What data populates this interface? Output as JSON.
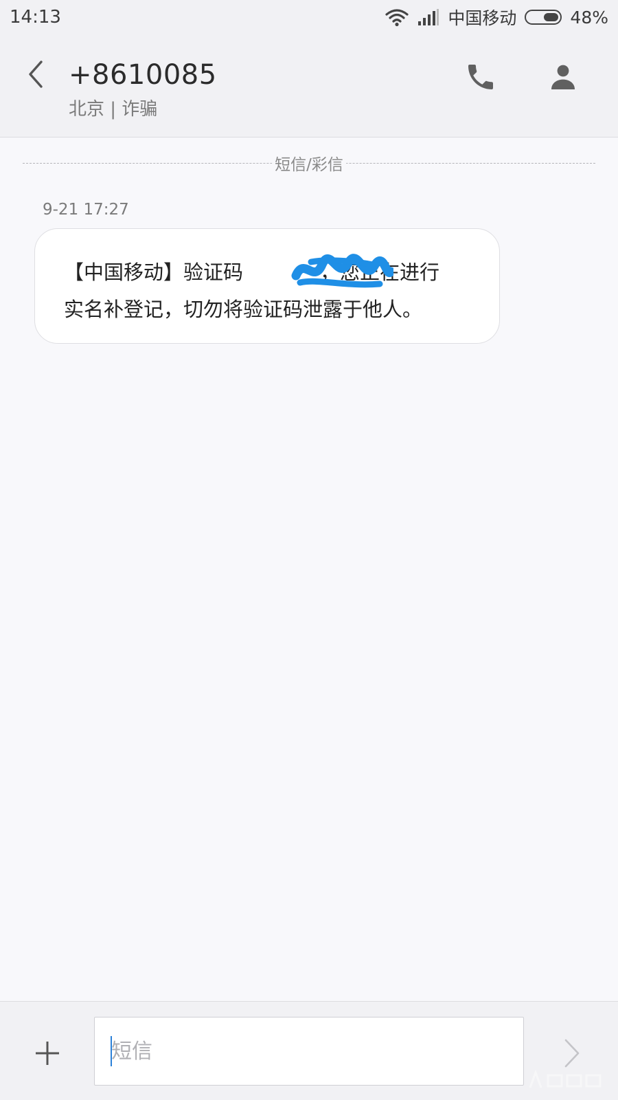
{
  "status_bar": {
    "time": "14:13",
    "carrier": "中国移动",
    "battery_percent": "48%",
    "battery_level": 0.48
  },
  "header": {
    "contact_name": "+8610085",
    "contact_subtitle": "北京 | 诈骗",
    "icons": {
      "back": "chevron-left-icon",
      "call": "phone-icon",
      "contact": "person-icon"
    }
  },
  "conversation": {
    "divider_label": "短信/彩信",
    "messages": [
      {
        "time": "9-21 17:27",
        "line1_before": "【中国移动】验证码",
        "line1_after": "，您正在进行",
        "line2": "实名补登记，切勿将验证码泄露于他人。",
        "redacted_code": true
      }
    ]
  },
  "input_bar": {
    "placeholder": "短信",
    "value": ""
  },
  "colors": {
    "background": "#f8f8fb",
    "header_background": "#f1f1f4",
    "bubble_background": "#ffffff",
    "redaction_scribble": "#1f8fe6",
    "caret": "#2a80d8"
  }
}
